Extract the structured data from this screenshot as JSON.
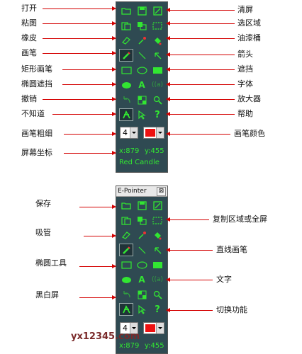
{
  "colors": {
    "panel_bg": "#2f4a52",
    "icon_green": "#32e632",
    "annotation_line": "#d40000",
    "pen_color": "#ee1111"
  },
  "panel1": {
    "annotations_left": [
      "打开",
      "粘图",
      "橡皮",
      "画笔",
      "矩形画笔",
      "椭圆遮挡",
      "撤销",
      "不知道",
      "画笔粗细",
      "屏幕坐标"
    ],
    "annotations_right": [
      "清屏",
      "选区域",
      "油漆桶",
      "箭头",
      "遮挡",
      "字体",
      "放大器",
      "帮助",
      "画笔颜色"
    ],
    "pen_width": "4",
    "coord_x": "x:879",
    "coord_y": "y:455",
    "pen_color_name": "Red Candle"
  },
  "panel2": {
    "title": "E-Pointer",
    "close_glyph": "⊠",
    "annotations_left": [
      "保存",
      "吸管",
      "椭圆工具",
      "黑白屏"
    ],
    "annotations_right": [
      "复制区域或全屏",
      "直线画笔",
      "文字",
      "切换功能"
    ],
    "pen_width": "4",
    "coord_x": "x:879",
    "coord_y": "y:455"
  },
  "watermark": "yx12345.com",
  "icons": {
    "row1": [
      "open-folder-icon",
      "save-disk-icon",
      "clear-screen-icon"
    ],
    "row2": [
      "paste-icon",
      "copy-icon",
      "select-region-icon"
    ],
    "row3": [
      "eraser-icon",
      "eyedropper-icon",
      "paint-bucket-icon"
    ],
    "row4": [
      "pen-icon",
      "line-icon",
      "arrow-icon"
    ],
    "row5": [
      "rect-pen-icon",
      "ellipse-icon",
      "fill-rect-icon"
    ],
    "row6": [
      "ellipse-mask-icon",
      "font-icon",
      "text-icon"
    ],
    "row7": [
      "undo-icon",
      "black-white-icon",
      "magnifier-icon"
    ],
    "row8": [
      "switch-function-icon",
      "pointer-icon",
      "help-icon"
    ]
  }
}
